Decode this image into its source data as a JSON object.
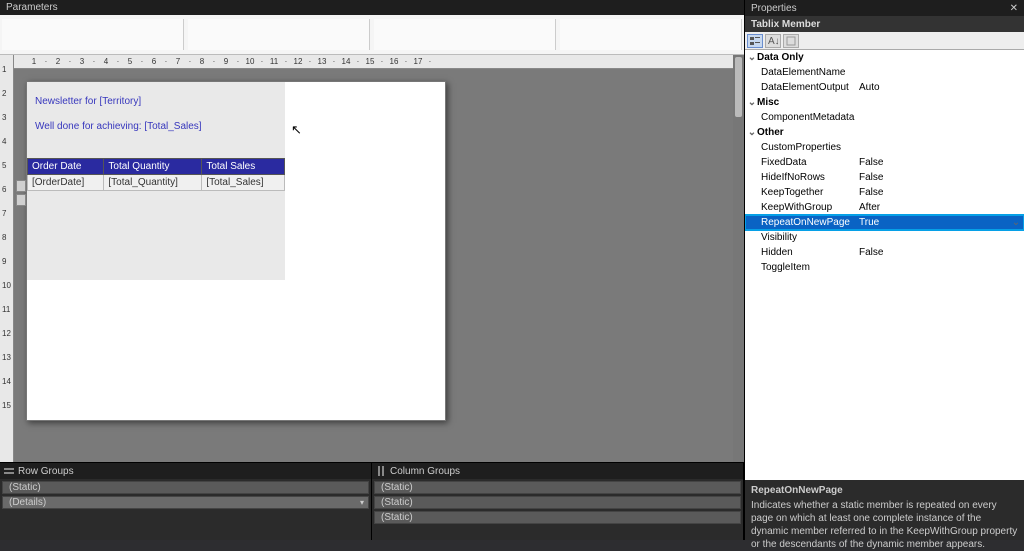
{
  "panels": {
    "parameters_title": "Parameters",
    "properties_title": "Properties",
    "row_groups_title": "Row Groups",
    "column_groups_title": "Column Groups"
  },
  "ruler_ticks": [
    "1",
    "2",
    "3",
    "4",
    "5",
    "6",
    "7",
    "8",
    "9",
    "10",
    "11",
    "12",
    "13",
    "14",
    "15",
    "16",
    "17"
  ],
  "vruler_ticks": [
    "1",
    "2",
    "3",
    "4",
    "5",
    "6",
    "7",
    "8",
    "9",
    "10",
    "11",
    "12",
    "13",
    "14",
    "15"
  ],
  "report": {
    "newsletter_line1": "Newsletter for [Territory]",
    "newsletter_line2": "Well done for achieving: [Total_Sales]",
    "table": {
      "headers": [
        "Order Date",
        "Total Quantity",
        "Total Sales"
      ],
      "row": [
        "[OrderDate]",
        "[Total_Quantity]",
        "[Total_Sales]"
      ]
    }
  },
  "row_groups": [
    "(Static)",
    "(Details)"
  ],
  "column_groups": [
    "(Static)",
    "(Static)",
    "(Static)"
  ],
  "properties": {
    "subject": "Tablix Member",
    "categories": [
      {
        "name": "Data Only",
        "rows": [
          {
            "name": "DataElementName",
            "value": ""
          },
          {
            "name": "DataElementOutput",
            "value": "Auto"
          }
        ]
      },
      {
        "name": "Misc",
        "rows": [
          {
            "name": "ComponentMetadata",
            "value": ""
          }
        ]
      },
      {
        "name": "Other",
        "rows": [
          {
            "name": "CustomProperties",
            "value": ""
          },
          {
            "name": "FixedData",
            "value": "False"
          },
          {
            "name": "HideIfNoRows",
            "value": "False"
          },
          {
            "name": "KeepTogether",
            "value": "False"
          },
          {
            "name": "KeepWithGroup",
            "value": "After"
          },
          {
            "name": "RepeatOnNewPage",
            "value": "True",
            "selected": true
          },
          {
            "name": "Visibility",
            "value": ""
          },
          {
            "name": "Hidden",
            "value": "False"
          },
          {
            "name": "ToggleItem",
            "value": ""
          }
        ]
      }
    ],
    "description": {
      "title": "RepeatOnNewPage",
      "body": "Indicates whether a static member is repeated on every page on which at least one complete instance of the dynamic member referred to in the KeepWithGroup property or the descendants of the dynamic member appears."
    }
  }
}
